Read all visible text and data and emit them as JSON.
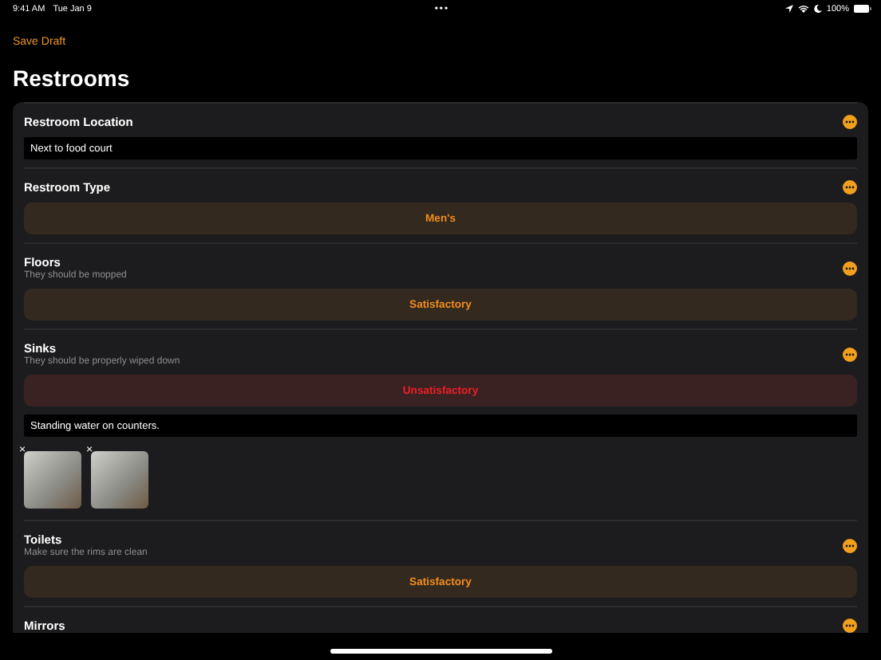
{
  "status_bar": {
    "time": "9:41 AM",
    "date": "Tue Jan 9",
    "multitask": "•••",
    "battery": "100%"
  },
  "nav": {
    "back": "Save Draft",
    "title": "Restrooms"
  },
  "sections": [
    {
      "kind": "text",
      "title": "Restroom Location",
      "value": "Next to food court"
    },
    {
      "kind": "choice",
      "title": "Restroom Type",
      "answer": "Men's",
      "color": "#33291e"
    },
    {
      "kind": "choice",
      "title": "Floors",
      "subtitle": "They should be mopped",
      "answer": "Satisfactory",
      "color": "#33291e"
    },
    {
      "kind": "choice",
      "title": "Sinks",
      "subtitle": "They should be properly wiped down",
      "answer": "Unsatisfactory",
      "color": "#3a2223",
      "note": "Standing water on counters.",
      "photos": [
        {
          "remove": "×"
        },
        {
          "remove": "×"
        }
      ]
    },
    {
      "kind": "choice",
      "title": "Toilets",
      "subtitle": "Make sure the rims are clean",
      "answer": "Satisfactory",
      "color": "#33291e"
    },
    {
      "kind": "header",
      "title": "Mirrors"
    }
  ]
}
